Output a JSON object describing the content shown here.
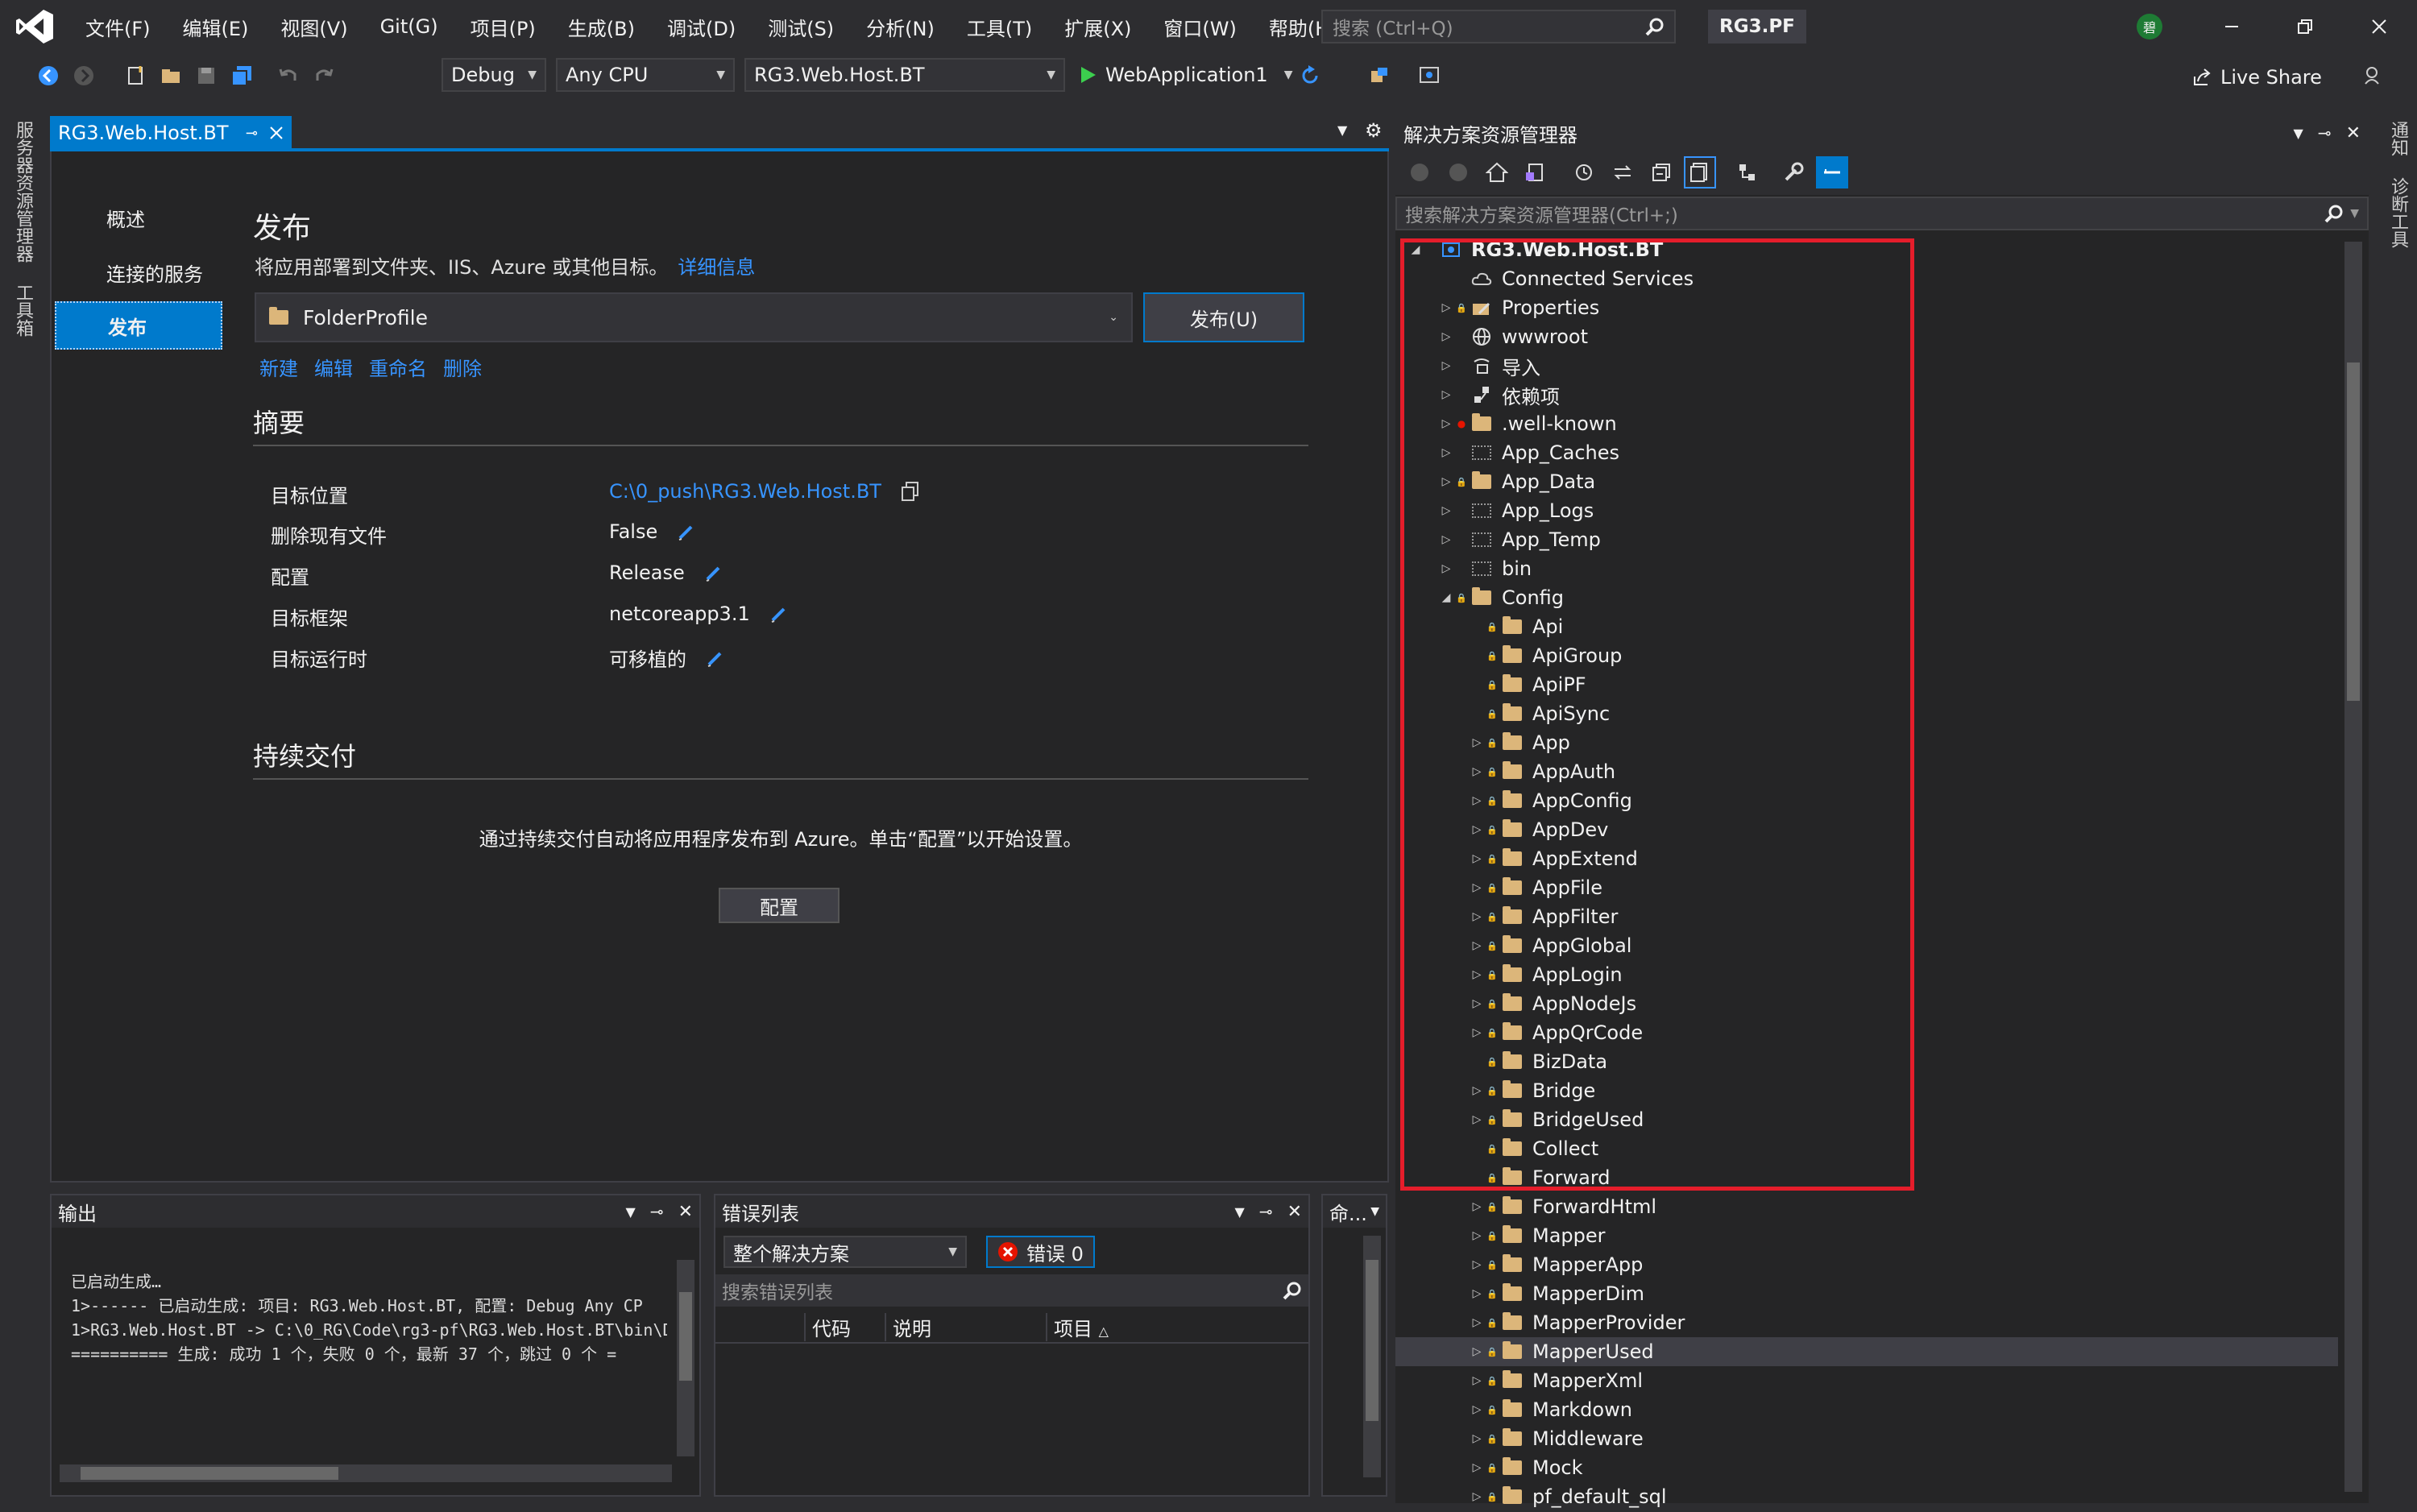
{
  "menu": [
    "文件(F)",
    "编辑(E)",
    "视图(V)",
    "Git(G)",
    "项目(P)",
    "生成(B)",
    "调试(D)",
    "测试(S)",
    "分析(N)",
    "工具(T)",
    "扩展(X)",
    "窗口(W)",
    "帮助(H)"
  ],
  "search": {
    "placeholder": "搜索 (Ctrl+Q)"
  },
  "solution_name": "RG3.PF",
  "user_initial": "碧",
  "toolbar": {
    "config": "Debug",
    "platform": "Any CPU",
    "startup_project": "RG3.Web.Host.BT",
    "run_target": "WebApplication1",
    "live_share": "Live Share"
  },
  "left_rail": [
    "服务器资源管理器",
    "工具箱"
  ],
  "right_rail": [
    "通知",
    "诊断工具"
  ],
  "doc_tab": {
    "label": "RG3.Web.Host.BT"
  },
  "publish": {
    "nav": [
      "概述",
      "连接的服务",
      "发布"
    ],
    "title": "发布",
    "description": "将应用部署到文件夹、IIS、Azure 或其他目标。",
    "details_link": "详细信息",
    "profile": "FolderProfile",
    "publish_button": "发布(U)",
    "actions": [
      "新建",
      "编辑",
      "重命名",
      "删除"
    ],
    "summary_title": "摘要",
    "summary": [
      {
        "key": "目标位置",
        "value": "C:\\0_push\\RG3.Web.Host.BT"
      },
      {
        "key": "删除现有文件",
        "value": "False"
      },
      {
        "key": "配置",
        "value": "Release"
      },
      {
        "key": "目标框架",
        "value": "netcoreapp3.1"
      },
      {
        "key": "目标运行时",
        "value": "可移植的"
      }
    ],
    "cd_title": "持续交付",
    "cd_description": "通过持续交付自动将应用程序发布到 Azure。单击“配置”以开始设置。",
    "config_button": "配置"
  },
  "output": {
    "title": "输出",
    "lines": [
      "已启动生成…",
      "1>------ 已启动生成: 项目: RG3.Web.Host.BT, 配置: Debug Any CP",
      "1>RG3.Web.Host.BT -> C:\\0_RG\\Code\\rg3-pf\\RG3.Web.Host.BT\\bin\\D",
      "========== 生成: 成功 1 个，失败 0 个，最新 37 个，跳过 0 个 ="
    ]
  },
  "error_list": {
    "title": "错误列表",
    "scope": "整个解决方案",
    "errors_label": "错误 0",
    "search_placeholder": "搜索错误列表",
    "columns": [
      "代码",
      "说明",
      "项目"
    ]
  },
  "command_panel": {
    "title": "命..."
  },
  "solution_explorer": {
    "title": "解决方案资源管理器",
    "search_placeholder": "搜索解决方案资源管理器(Ctrl+;)",
    "tree": [
      {
        "label": "RG3.Web.Host.BT",
        "level": 0,
        "expander": "open",
        "icon": "project",
        "bold": true
      },
      {
        "label": "Connected Services",
        "level": 1,
        "expander": "none",
        "icon": "cloud"
      },
      {
        "label": "Properties",
        "level": 1,
        "expander": "closed",
        "icon": "properties",
        "lock": true
      },
      {
        "label": "wwwroot",
        "level": 1,
        "expander": "closed",
        "icon": "globe"
      },
      {
        "label": "导入",
        "level": 1,
        "expander": "closed",
        "icon": "import"
      },
      {
        "label": "依赖项",
        "level": 1,
        "expander": "closed",
        "icon": "deps"
      },
      {
        "label": ".well-known",
        "level": 1,
        "expander": "closed",
        "icon": "folder",
        "red_dot": true
      },
      {
        "label": "App_Caches",
        "level": 1,
        "expander": "closed",
        "icon": "folder-empty"
      },
      {
        "label": "App_Data",
        "level": 1,
        "expander": "closed",
        "icon": "folder",
        "lock": true
      },
      {
        "label": "App_Logs",
        "level": 1,
        "expander": "closed",
        "icon": "folder-empty"
      },
      {
        "label": "App_Temp",
        "level": 1,
        "expander": "closed",
        "icon": "folder-empty"
      },
      {
        "label": "bin",
        "level": 1,
        "expander": "closed",
        "icon": "folder-empty"
      },
      {
        "label": "Config",
        "level": 1,
        "expander": "open",
        "icon": "folder",
        "lock": true
      },
      {
        "label": "Api",
        "level": 2,
        "expander": "none",
        "icon": "folder",
        "lock": true
      },
      {
        "label": "ApiGroup",
        "level": 2,
        "expander": "none",
        "icon": "folder",
        "lock": true
      },
      {
        "label": "ApiPF",
        "level": 2,
        "expander": "none",
        "icon": "folder",
        "lock": true
      },
      {
        "label": "ApiSync",
        "level": 2,
        "expander": "none",
        "icon": "folder",
        "lock": true
      },
      {
        "label": "App",
        "level": 2,
        "expander": "closed",
        "icon": "folder",
        "lock": true
      },
      {
        "label": "AppAuth",
        "level": 2,
        "expander": "closed",
        "icon": "folder",
        "lock": true
      },
      {
        "label": "AppConfig",
        "level": 2,
        "expander": "closed",
        "icon": "folder",
        "lock": true
      },
      {
        "label": "AppDev",
        "level": 2,
        "expander": "closed",
        "icon": "folder",
        "lock": true
      },
      {
        "label": "AppExtend",
        "level": 2,
        "expander": "closed",
        "icon": "folder",
        "lock": true
      },
      {
        "label": "AppFile",
        "level": 2,
        "expander": "closed",
        "icon": "folder",
        "lock": true
      },
      {
        "label": "AppFilter",
        "level": 2,
        "expander": "closed",
        "icon": "folder",
        "lock": true
      },
      {
        "label": "AppGlobal",
        "level": 2,
        "expander": "closed",
        "icon": "folder",
        "lock": true
      },
      {
        "label": "AppLogin",
        "level": 2,
        "expander": "closed",
        "icon": "folder",
        "lock": true
      },
      {
        "label": "AppNodeJs",
        "level": 2,
        "expander": "closed",
        "icon": "folder",
        "lock": true
      },
      {
        "label": "AppQrCode",
        "level": 2,
        "expander": "closed",
        "icon": "folder",
        "lock": true
      },
      {
        "label": "BizData",
        "level": 2,
        "expander": "none",
        "icon": "folder",
        "lock": true
      },
      {
        "label": "Bridge",
        "level": 2,
        "expander": "closed",
        "icon": "folder",
        "lock": true
      },
      {
        "label": "BridgeUsed",
        "level": 2,
        "expander": "closed",
        "icon": "folder",
        "lock": true
      },
      {
        "label": "Collect",
        "level": 2,
        "expander": "none",
        "icon": "folder",
        "lock": true
      },
      {
        "label": "Forward",
        "level": 2,
        "expander": "none",
        "icon": "folder",
        "lock": true
      },
      {
        "label": "ForwardHtml",
        "level": 2,
        "expander": "closed",
        "icon": "folder",
        "lock": true
      },
      {
        "label": "Mapper",
        "level": 2,
        "expander": "closed",
        "icon": "folder",
        "lock": true
      },
      {
        "label": "MapperApp",
        "level": 2,
        "expander": "closed",
        "icon": "folder",
        "lock": true
      },
      {
        "label": "MapperDim",
        "level": 2,
        "expander": "closed",
        "icon": "folder",
        "lock": true
      },
      {
        "label": "MapperProvider",
        "level": 2,
        "expander": "closed",
        "icon": "folder",
        "lock": true
      },
      {
        "label": "MapperUsed",
        "level": 2,
        "expander": "closed",
        "icon": "folder",
        "lock": true,
        "selected": true
      },
      {
        "label": "MapperXml",
        "level": 2,
        "expander": "closed",
        "icon": "folder",
        "lock": true
      },
      {
        "label": "Markdown",
        "level": 2,
        "expander": "closed",
        "icon": "folder",
        "lock": true
      },
      {
        "label": "Middleware",
        "level": 2,
        "expander": "closed",
        "icon": "folder",
        "lock": true
      },
      {
        "label": "Mock",
        "level": 2,
        "expander": "closed",
        "icon": "folder",
        "lock": true
      },
      {
        "label": "pf_default_sql",
        "level": 2,
        "expander": "closed",
        "icon": "folder",
        "lock": true
      }
    ]
  },
  "colors": {
    "accent": "#007acc",
    "highlight": "#e51d2b",
    "folder": "#dcb67a",
    "link": "#3794ff"
  }
}
